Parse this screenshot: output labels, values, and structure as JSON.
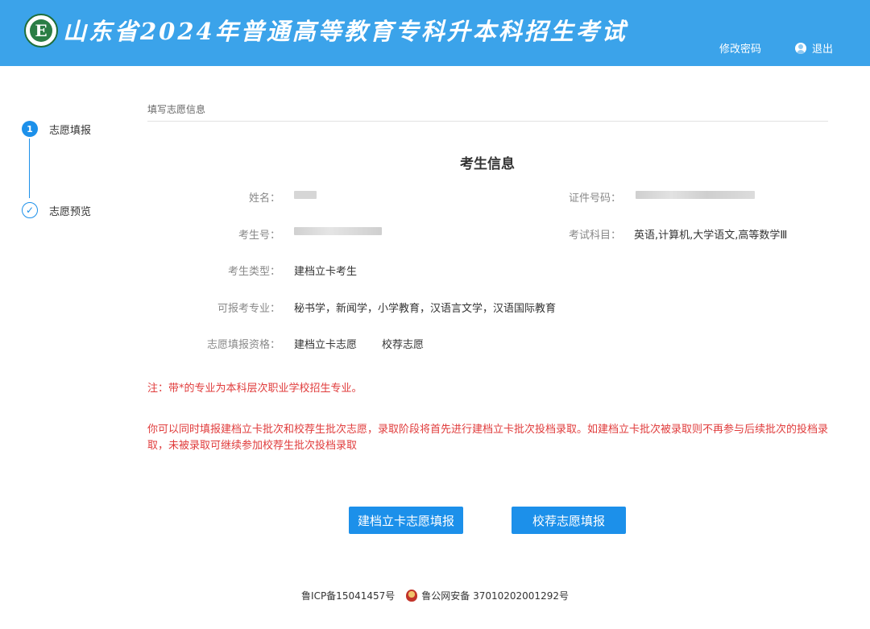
{
  "header": {
    "title": "山东省2024年普通高等教育专科升本科招生考试",
    "change_password": "修改密码",
    "logout": "退出"
  },
  "steps": [
    {
      "number": "1",
      "label": "志愿填报",
      "state": "active"
    },
    {
      "icon": "check-icon",
      "label": "志愿预览",
      "state": "done"
    }
  ],
  "section_title": "填写志愿信息",
  "candidate": {
    "heading": "考生信息",
    "name_label": "姓名：",
    "id_label": "证件号码：",
    "exam_no_label": "考生号：",
    "subjects_label": "考试科目：",
    "subjects_value": "英语,计算机,大学语文,高等数学Ⅲ",
    "type_label": "考生类型：",
    "type_value": "建档立卡考生",
    "majors_label": "可报考专业：",
    "majors_value": "秘书学，新闻学，小学教育，汉语言文学，汉语国际教育",
    "qualification_label": "志愿填报资格：",
    "qualification_values": [
      "建档立卡志愿",
      "校荐志愿"
    ]
  },
  "notices": {
    "note": "注：带*的专业为本科层次职业学校招生专业。",
    "info": "你可以同时填报建档立卡批次和校荐生批次志愿，录取阶段将首先进行建档立卡批次投档录取。如建档立卡批次被录取则不再参与后续批次的投档录取，未被录取可继续参加校荐生批次投档录取"
  },
  "buttons": {
    "poverty": "建档立卡志愿填报",
    "school": "校荐志愿填报"
  },
  "footer": {
    "icp": "鲁ICP备15041457号",
    "police": "鲁公网安备 37010202001292号"
  },
  "colors": {
    "header_bg": "#3ba3ea",
    "accent": "#1c90ea",
    "notice_red": "#e03c3c"
  }
}
